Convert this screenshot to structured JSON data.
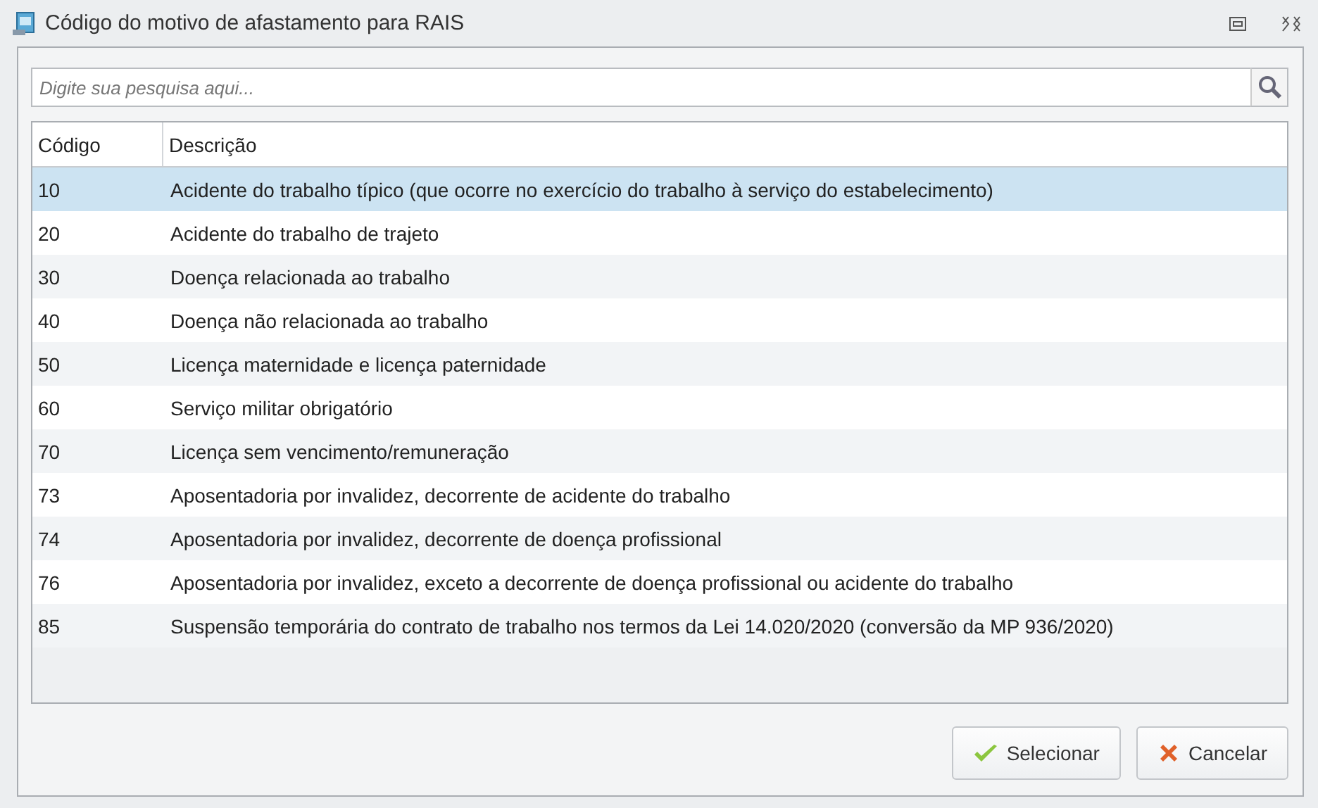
{
  "window": {
    "title": "Código do motivo de afastamento para RAIS"
  },
  "search": {
    "placeholder": "Digite sua pesquisa aqui..."
  },
  "table": {
    "columns": [
      "Código",
      "Descrição"
    ],
    "rows": [
      {
        "code": "10",
        "description": "Acidente do trabalho típico (que ocorre no exercício do trabalho à serviço do estabelecimento)",
        "selected": true
      },
      {
        "code": "20",
        "description": "Acidente do trabalho de trajeto",
        "selected": false
      },
      {
        "code": "30",
        "description": "Doença relacionada ao trabalho",
        "selected": false
      },
      {
        "code": "40",
        "description": "Doença não relacionada ao trabalho",
        "selected": false
      },
      {
        "code": "50",
        "description": "Licença maternidade e licença paternidade",
        "selected": false
      },
      {
        "code": "60",
        "description": "Serviço militar obrigatório",
        "selected": false
      },
      {
        "code": "70",
        "description": "Licença sem vencimento/remuneração",
        "selected": false
      },
      {
        "code": "73",
        "description": "Aposentadoria por invalidez, decorrente de acidente do trabalho",
        "selected": false
      },
      {
        "code": "74",
        "description": "Aposentadoria por invalidez, decorrente de doença profissional",
        "selected": false
      },
      {
        "code": "76",
        "description": "Aposentadoria por invalidez, exceto a decorrente de doença profissional ou acidente do trabalho",
        "selected": false
      },
      {
        "code": "85",
        "description": "Suspensão temporária do contrato de trabalho nos termos da Lei 14.020/2020 (conversão da MP 936/2020)",
        "selected": false
      }
    ]
  },
  "buttons": [
    {
      "kind": "confirm",
      "label": "Selecionar"
    },
    {
      "kind": "cancel",
      "label": "Cancelar"
    }
  ]
}
